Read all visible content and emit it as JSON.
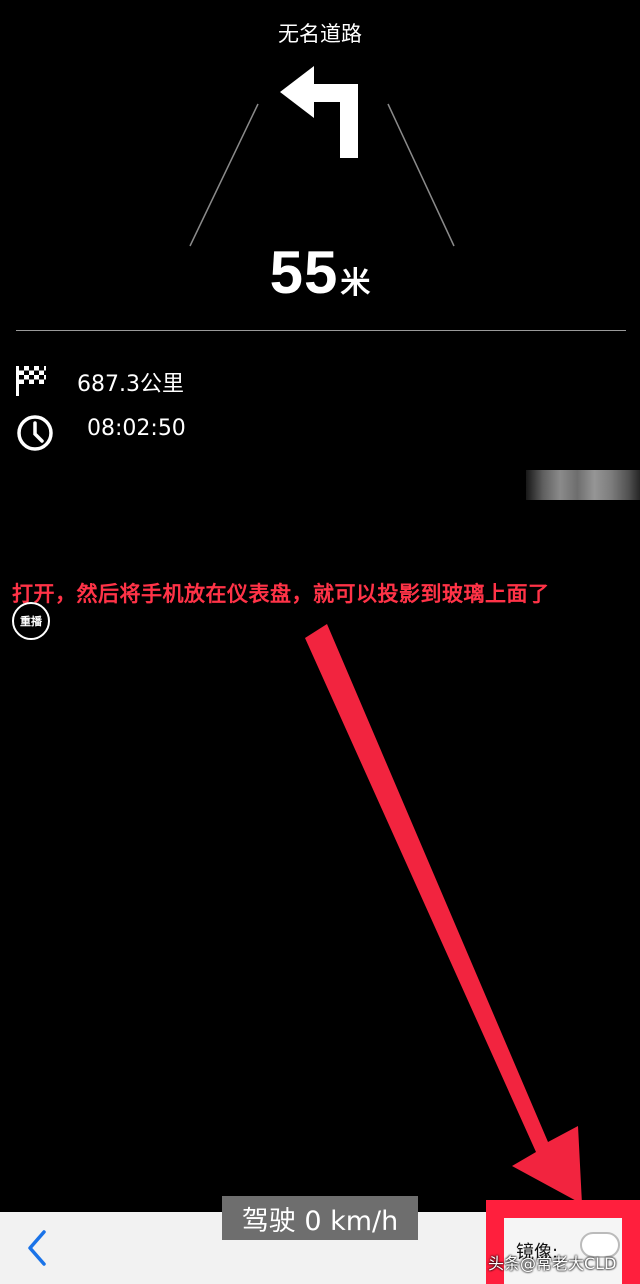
{
  "navigation": {
    "road_name": "无名道路",
    "distance_value": "55",
    "distance_unit": "米"
  },
  "trip_info": {
    "remaining_distance": "687.3公里",
    "eta": "08:02:50"
  },
  "annotation": {
    "text": "打开，然后将手机放在仪表盘，就可以投影到玻璃上面了",
    "color": "#ff3347"
  },
  "controls": {
    "replay_label": "重播",
    "speed_label": "驾驶 0 km/h",
    "mirror_label": "镜像:",
    "mirror_enabled": false
  },
  "watermark": "头条@常老大CLD",
  "icons": [
    "turn-left-arrow-icon",
    "checkered-flag-icon",
    "clock-icon",
    "back-chevron-icon"
  ],
  "colors": {
    "background": "#000000",
    "highlight": "#ff1f3d",
    "back_chevron": "#1a73e8"
  }
}
